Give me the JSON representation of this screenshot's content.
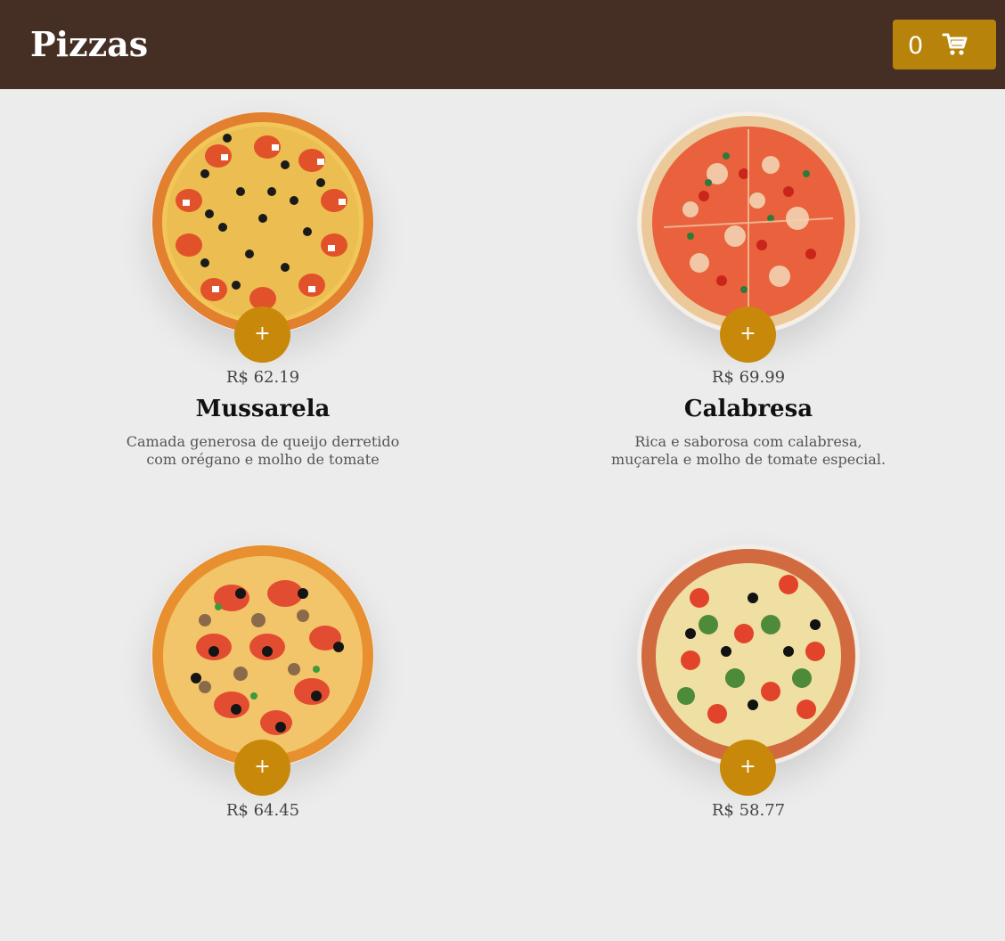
{
  "header": {
    "title": "Pizzas",
    "cart_count": "0",
    "cart_icon": "shopping-cart-icon"
  },
  "colors": {
    "header_bg": "#452f25",
    "accent": "#c8890a",
    "cart_button": "#b8830a",
    "page_bg": "#ececec"
  },
  "pizzas": [
    {
      "price": "R$ 62.19",
      "name": "Mussarela",
      "description": "Camada generosa de queijo derretido com orégano e molho de tomate",
      "add_label": "+"
    },
    {
      "price": "R$ 69.99",
      "name": "Calabresa",
      "description": "Rica e saborosa com calabresa, muçarela e molho de tomate especial.",
      "add_label": "+"
    },
    {
      "price": "R$ 64.45",
      "name": "",
      "description": "",
      "add_label": "+"
    },
    {
      "price": "R$ 58.77",
      "name": "",
      "description": "",
      "add_label": "+"
    }
  ]
}
